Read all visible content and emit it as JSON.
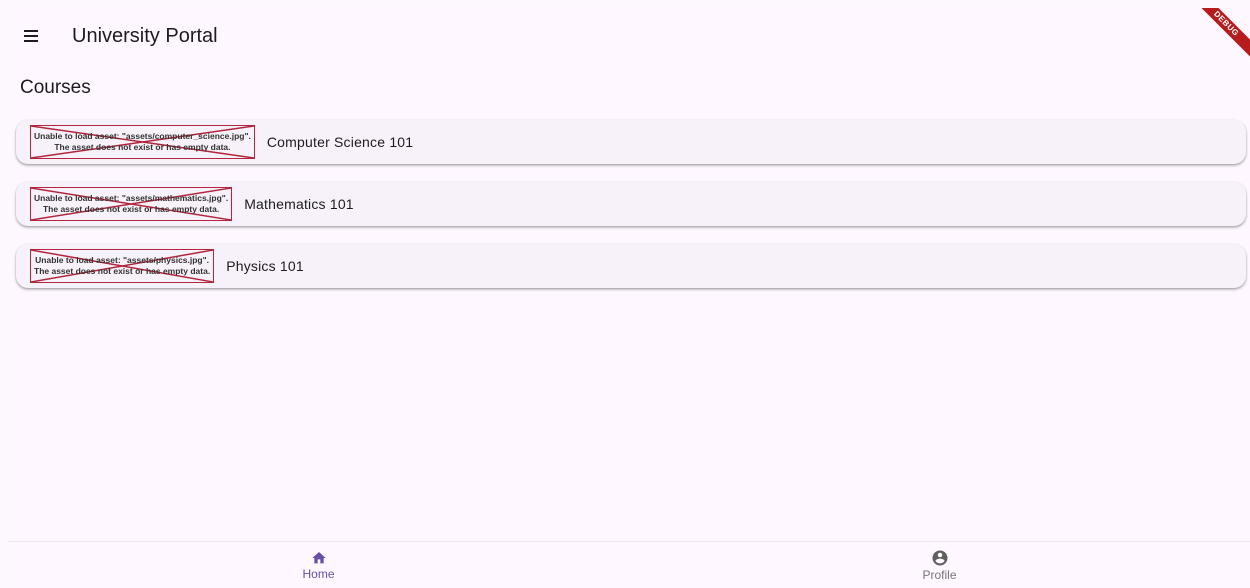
{
  "appbar": {
    "title": "University Portal",
    "menu_icon": "menu-icon"
  },
  "debug_banner": "DEBUG",
  "section_title": "Courses",
  "courses": [
    {
      "name": "Computer Science 101",
      "error_line1": "Unable to load asset: \"assets/computer_science.jpg\".",
      "error_line2": "The asset does not exist or has empty data."
    },
    {
      "name": "Mathematics 101",
      "error_line1": "Unable to load asset: \"assets/mathematics.jpg\".",
      "error_line2": "The asset does not exist or has empty data."
    },
    {
      "name": "Physics 101",
      "error_line1": "Unable to load asset: \"assets/physics.jpg\".",
      "error_line2": "The asset does not exist or has empty data."
    }
  ],
  "bottom_nav": {
    "items": [
      {
        "label": "Home",
        "icon": "home-icon",
        "active": true
      },
      {
        "label": "Profile",
        "icon": "account-circle-icon",
        "active": false
      }
    ]
  },
  "colors": {
    "accent": "#6750a4",
    "error_border": "#b2253c",
    "background": "#fef7ff",
    "card": "#f7f1f9",
    "debug": "#b71c1c"
  }
}
